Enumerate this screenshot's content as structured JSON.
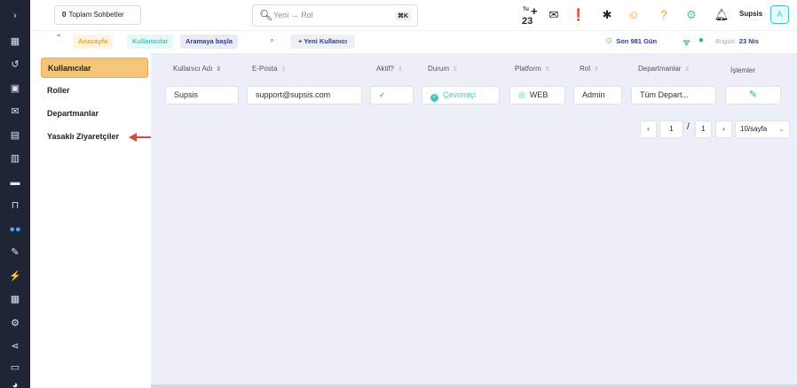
{
  "rail_icons": [
    "chevron-right-icon",
    "chat-icon",
    "history-icon",
    "contacts-icon",
    "mail-icon",
    "calendar-icon",
    "clipboard-icon",
    "ticket-icon",
    "inbox-icon",
    "users-icon",
    "pen-icon",
    "bolt-icon",
    "grid-icon",
    "settings-icon",
    "share-icon",
    "monitor-icon",
    "pie-icon"
  ],
  "topbar": {
    "chats_count": "0",
    "chats_label": "Toplam Sohbetler",
    "search_placeholder": "Yeni → Rol",
    "search_shortcut": "⌘K",
    "date_day": "Tu",
    "date_num": "23",
    "user_name": "Supsis",
    "avatar_letter": "A"
  },
  "subbar": {
    "home": "Anasayfa",
    "users": "Kullanıcılar",
    "start_search": "Aramaya başla",
    "new_user": "+ Yeni Kullanıcı",
    "last_days": "Son 981 Gün",
    "today_label": "Bugün:",
    "today_value": "23 Nis"
  },
  "sidemenu": {
    "items": [
      "Kullanıcılar",
      "Roller",
      "Departmanlar",
      "Yasaklı Ziyaretçiler"
    ]
  },
  "table": {
    "headers": [
      "Kullanıcı Adı",
      "E-Posta",
      "Aktif?",
      "Durum",
      "Platform",
      "Rol",
      "Departmanlar",
      "İşlemler"
    ],
    "row": {
      "username": "Supsis",
      "email": "support@supsis.com",
      "active": "✓",
      "status": "Çevrimiçi",
      "platform": "WEB",
      "role": "Admin",
      "departments": "Tüm Depart..."
    }
  },
  "pagination": {
    "prev": "‹",
    "page": "1",
    "slash": "/",
    "total": "1",
    "next": "›",
    "per_page": "10/sayfa"
  },
  "colors": {
    "rail": "#1f2535",
    "accent_orange": "#f5c57a",
    "accent_teal": "#3fc8c0",
    "content_bg": "#eceef8",
    "arrow": "#d9483b"
  }
}
